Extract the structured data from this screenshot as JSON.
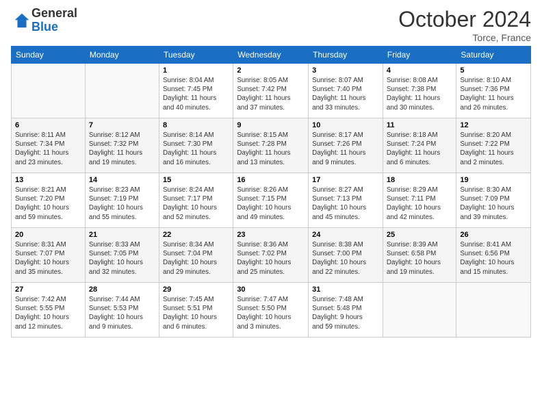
{
  "logo": {
    "general": "General",
    "blue": "Blue"
  },
  "title": "October 2024",
  "location": "Torce, France",
  "days_of_week": [
    "Sunday",
    "Monday",
    "Tuesday",
    "Wednesday",
    "Thursday",
    "Friday",
    "Saturday"
  ],
  "weeks": [
    [
      {
        "day": "",
        "info": ""
      },
      {
        "day": "",
        "info": ""
      },
      {
        "day": "1",
        "info": "Sunrise: 8:04 AM\nSunset: 7:45 PM\nDaylight: 11 hours\nand 40 minutes."
      },
      {
        "day": "2",
        "info": "Sunrise: 8:05 AM\nSunset: 7:42 PM\nDaylight: 11 hours\nand 37 minutes."
      },
      {
        "day": "3",
        "info": "Sunrise: 8:07 AM\nSunset: 7:40 PM\nDaylight: 11 hours\nand 33 minutes."
      },
      {
        "day": "4",
        "info": "Sunrise: 8:08 AM\nSunset: 7:38 PM\nDaylight: 11 hours\nand 30 minutes."
      },
      {
        "day": "5",
        "info": "Sunrise: 8:10 AM\nSunset: 7:36 PM\nDaylight: 11 hours\nand 26 minutes."
      }
    ],
    [
      {
        "day": "6",
        "info": "Sunrise: 8:11 AM\nSunset: 7:34 PM\nDaylight: 11 hours\nand 23 minutes."
      },
      {
        "day": "7",
        "info": "Sunrise: 8:12 AM\nSunset: 7:32 PM\nDaylight: 11 hours\nand 19 minutes."
      },
      {
        "day": "8",
        "info": "Sunrise: 8:14 AM\nSunset: 7:30 PM\nDaylight: 11 hours\nand 16 minutes."
      },
      {
        "day": "9",
        "info": "Sunrise: 8:15 AM\nSunset: 7:28 PM\nDaylight: 11 hours\nand 13 minutes."
      },
      {
        "day": "10",
        "info": "Sunrise: 8:17 AM\nSunset: 7:26 PM\nDaylight: 11 hours\nand 9 minutes."
      },
      {
        "day": "11",
        "info": "Sunrise: 8:18 AM\nSunset: 7:24 PM\nDaylight: 11 hours\nand 6 minutes."
      },
      {
        "day": "12",
        "info": "Sunrise: 8:20 AM\nSunset: 7:22 PM\nDaylight: 11 hours\nand 2 minutes."
      }
    ],
    [
      {
        "day": "13",
        "info": "Sunrise: 8:21 AM\nSunset: 7:20 PM\nDaylight: 10 hours\nand 59 minutes."
      },
      {
        "day": "14",
        "info": "Sunrise: 8:23 AM\nSunset: 7:19 PM\nDaylight: 10 hours\nand 55 minutes."
      },
      {
        "day": "15",
        "info": "Sunrise: 8:24 AM\nSunset: 7:17 PM\nDaylight: 10 hours\nand 52 minutes."
      },
      {
        "day": "16",
        "info": "Sunrise: 8:26 AM\nSunset: 7:15 PM\nDaylight: 10 hours\nand 49 minutes."
      },
      {
        "day": "17",
        "info": "Sunrise: 8:27 AM\nSunset: 7:13 PM\nDaylight: 10 hours\nand 45 minutes."
      },
      {
        "day": "18",
        "info": "Sunrise: 8:29 AM\nSunset: 7:11 PM\nDaylight: 10 hours\nand 42 minutes."
      },
      {
        "day": "19",
        "info": "Sunrise: 8:30 AM\nSunset: 7:09 PM\nDaylight: 10 hours\nand 39 minutes."
      }
    ],
    [
      {
        "day": "20",
        "info": "Sunrise: 8:31 AM\nSunset: 7:07 PM\nDaylight: 10 hours\nand 35 minutes."
      },
      {
        "day": "21",
        "info": "Sunrise: 8:33 AM\nSunset: 7:05 PM\nDaylight: 10 hours\nand 32 minutes."
      },
      {
        "day": "22",
        "info": "Sunrise: 8:34 AM\nSunset: 7:04 PM\nDaylight: 10 hours\nand 29 minutes."
      },
      {
        "day": "23",
        "info": "Sunrise: 8:36 AM\nSunset: 7:02 PM\nDaylight: 10 hours\nand 25 minutes."
      },
      {
        "day": "24",
        "info": "Sunrise: 8:38 AM\nSunset: 7:00 PM\nDaylight: 10 hours\nand 22 minutes."
      },
      {
        "day": "25",
        "info": "Sunrise: 8:39 AM\nSunset: 6:58 PM\nDaylight: 10 hours\nand 19 minutes."
      },
      {
        "day": "26",
        "info": "Sunrise: 8:41 AM\nSunset: 6:56 PM\nDaylight: 10 hours\nand 15 minutes."
      }
    ],
    [
      {
        "day": "27",
        "info": "Sunrise: 7:42 AM\nSunset: 5:55 PM\nDaylight: 10 hours\nand 12 minutes."
      },
      {
        "day": "28",
        "info": "Sunrise: 7:44 AM\nSunset: 5:53 PM\nDaylight: 10 hours\nand 9 minutes."
      },
      {
        "day": "29",
        "info": "Sunrise: 7:45 AM\nSunset: 5:51 PM\nDaylight: 10 hours\nand 6 minutes."
      },
      {
        "day": "30",
        "info": "Sunrise: 7:47 AM\nSunset: 5:50 PM\nDaylight: 10 hours\nand 3 minutes."
      },
      {
        "day": "31",
        "info": "Sunrise: 7:48 AM\nSunset: 5:48 PM\nDaylight: 9 hours\nand 59 minutes."
      },
      {
        "day": "",
        "info": ""
      },
      {
        "day": "",
        "info": ""
      }
    ]
  ]
}
